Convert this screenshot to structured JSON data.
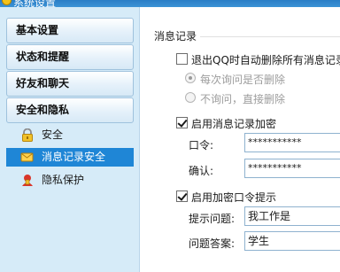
{
  "window": {
    "title": "系统设置"
  },
  "sidebar": {
    "groups": [
      {
        "label": "基本设置"
      },
      {
        "label": "状态和提醒"
      },
      {
        "label": "好友和聊天"
      },
      {
        "label": "安全和隐私"
      }
    ],
    "items": [
      {
        "label": "安全",
        "icon": "lock-icon"
      },
      {
        "label": "消息记录安全",
        "icon": "message-record-icon",
        "selected": true
      },
      {
        "label": "隐私保护",
        "icon": "privacy-icon"
      }
    ],
    "selected_color": "#1f86d6"
  },
  "panel": {
    "section_title": "消息记录",
    "exit_delete": {
      "label": "退出QQ时自动删除所有消息记录",
      "checked": false
    },
    "radio_ask": {
      "label": "每次询问是否删除",
      "checked": true,
      "disabled": true
    },
    "radio_noask": {
      "label": "不询问，直接删除",
      "checked": false,
      "disabled": true
    },
    "encrypt": {
      "label": "启用消息记录加密",
      "checked": true
    },
    "password_label": "口令:",
    "password_value": "***********",
    "confirm_label": "确认:",
    "confirm_value": "***********",
    "hint": {
      "label": "启用加密口令提示",
      "checked": true
    },
    "question_label": "提示问题:",
    "question_value": "我工作是",
    "answer_label": "问题答案:",
    "answer_value": "学生"
  }
}
